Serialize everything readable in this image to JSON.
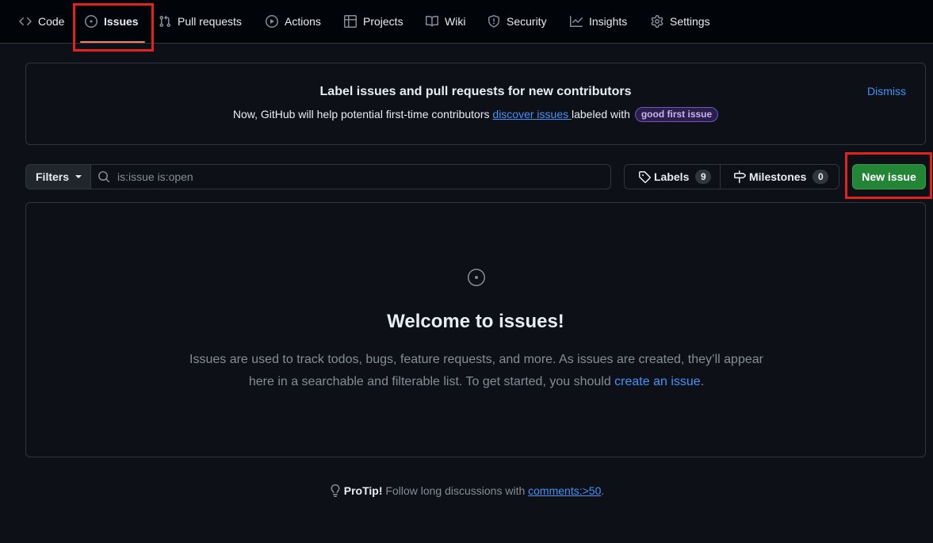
{
  "nav": {
    "items": [
      {
        "label": "Code",
        "icon": "code-icon"
      },
      {
        "label": "Issues",
        "icon": "issue-opened-icon",
        "selected": true
      },
      {
        "label": "Pull requests",
        "icon": "git-pull-request-icon"
      },
      {
        "label": "Actions",
        "icon": "play-icon"
      },
      {
        "label": "Projects",
        "icon": "table-icon"
      },
      {
        "label": "Wiki",
        "icon": "book-icon"
      },
      {
        "label": "Security",
        "icon": "shield-icon"
      },
      {
        "label": "Insights",
        "icon": "graph-icon"
      },
      {
        "label": "Settings",
        "icon": "gear-icon"
      }
    ]
  },
  "banner": {
    "title": "Label issues and pull requests for new contributors",
    "text_before": "Now, GitHub will help potential first-time contributors ",
    "link": "discover issues ",
    "text_after": "labeled with ",
    "label": "good first issue",
    "dismiss": "Dismiss"
  },
  "toolbar": {
    "filters_label": "Filters",
    "search_value": "is:issue is:open",
    "labels_label": "Labels",
    "labels_count": "9",
    "milestones_label": "Milestones",
    "milestones_count": "0",
    "new_issue_label": "New issue"
  },
  "blankslate": {
    "title": "Welcome to issues!",
    "text_before": "Issues are used to track todos, bugs, feature requests, and more. As issues are created, they’ll appear here in a searchable and filterable list. To get started, you should ",
    "link": "create an issue",
    "text_after": "."
  },
  "protip": {
    "bold": "ProTip!",
    "text": " Follow long discussions with ",
    "link": "comments:>50",
    "after": "."
  },
  "colors": {
    "background": "#0d1117",
    "nav_background": "#010409",
    "accent_link": "#4493f8",
    "primary_button": "#238636",
    "selected_underline": "#f78166",
    "highlight_box": "#e3221f"
  }
}
